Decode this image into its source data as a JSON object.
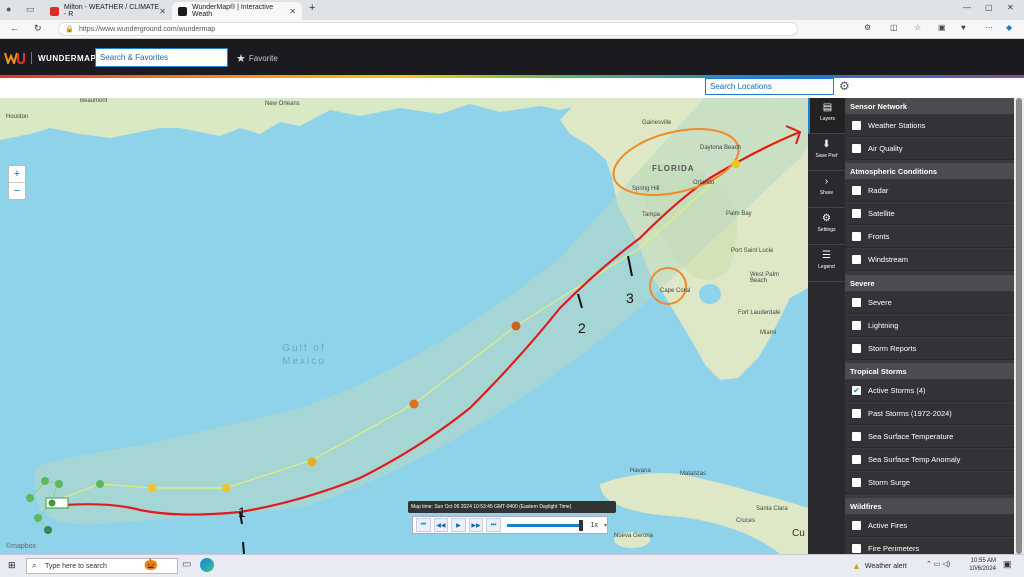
{
  "browser": {
    "tabs": [
      {
        "title": "Milton - WEATHER / CLIMATE - R",
        "active": false
      },
      {
        "title": "WunderMap® | Interactive Weath",
        "active": true
      }
    ],
    "url": "https://www.wunderground.com/wundermap",
    "new_tab_label": "+"
  },
  "header": {
    "logo_text": "WUNDERMAP",
    "search_favorites": "Search & Favorites",
    "favorite_label": "Favorite"
  },
  "locbar": {
    "search_locations": "Search Locations"
  },
  "map": {
    "labels": {
      "beaumont": "Beaumont",
      "houston": "Houston",
      "new_orleans": "New Orleans",
      "gainesville": "Gainesville",
      "florida": "FLORIDA",
      "daytona": "Daytona Beach",
      "spring_hill": "Spring Hill",
      "orlando": "Orlando",
      "tampa": "Tampa",
      "palm_bay": "Palm Bay",
      "port_st_lucie": "Port Saint Lucie",
      "west_palm": "West Palm Beach",
      "cape_coral": "Cape Coral",
      "fort_lauderdale": "Fort Lauderdale",
      "miami": "Miami",
      "gulf": "Gulf of Mexico",
      "havana": "Havana",
      "matanzas": "Matanzas",
      "santa_clara": "Santa Clara",
      "cruces": "Cruces",
      "nueva_gerona": "Nueva Gerona",
      "cu": "Cu"
    },
    "annotations": {
      "n1": "1",
      "n2": "2",
      "n3": "3"
    },
    "zoom_in": "+",
    "zoom_out": "−",
    "attribution": "©mapbox",
    "time_label": "Map time: Sun Oct 06 2024 10:53:45 GMT-0400 (Eastern Daylight Time)",
    "speed": "1x"
  },
  "sidebar": {
    "buttons": [
      {
        "label": "Layers",
        "icon": "layers-icon"
      },
      {
        "label": "Save Pref",
        "icon": "save-icon"
      },
      {
        "label": "Share",
        "icon": "share-icon"
      },
      {
        "label": "Settings",
        "icon": "gear-icon"
      },
      {
        "label": "Legend",
        "icon": "list-icon"
      }
    ]
  },
  "panel": {
    "sections": [
      {
        "title": "Sensor Network",
        "items": [
          {
            "label": "Weather Stations",
            "checked": false
          },
          {
            "label": "Air Quality",
            "checked": false
          }
        ]
      },
      {
        "title": "Atmospheric Conditions",
        "items": [
          {
            "label": "Radar",
            "checked": false
          },
          {
            "label": "Satellite",
            "checked": false
          },
          {
            "label": "Fronts",
            "checked": false
          },
          {
            "label": "Windstream",
            "checked": false
          }
        ]
      },
      {
        "title": "Severe",
        "items": [
          {
            "label": "Severe",
            "checked": false
          },
          {
            "label": "Lightning",
            "checked": false
          },
          {
            "label": "Storm Reports",
            "checked": false
          }
        ]
      },
      {
        "title": "Tropical Storms",
        "items": [
          {
            "label": "Active Storms (4)",
            "checked": true
          },
          {
            "label": "Past Storms (1972-2024)",
            "checked": false
          },
          {
            "label": "Sea Surface Temperature",
            "checked": false
          },
          {
            "label": "Sea Surface Temp Anomaly",
            "checked": false
          },
          {
            "label": "Storm Surge",
            "checked": false
          }
        ]
      },
      {
        "title": "Wildfires",
        "items": [
          {
            "label": "Active Fires",
            "checked": false
          },
          {
            "label": "Fire Perimeters",
            "checked": false
          }
        ]
      }
    ]
  },
  "taskbar": {
    "search_placeholder": "Type here to search",
    "weather_alert": "Weather alert",
    "time": "10:55 AM",
    "date": "10/6/2024"
  },
  "colors": {
    "accent": "#1c7fd2",
    "track_red": "#e01b1b",
    "cone": "#b8d9c2"
  }
}
